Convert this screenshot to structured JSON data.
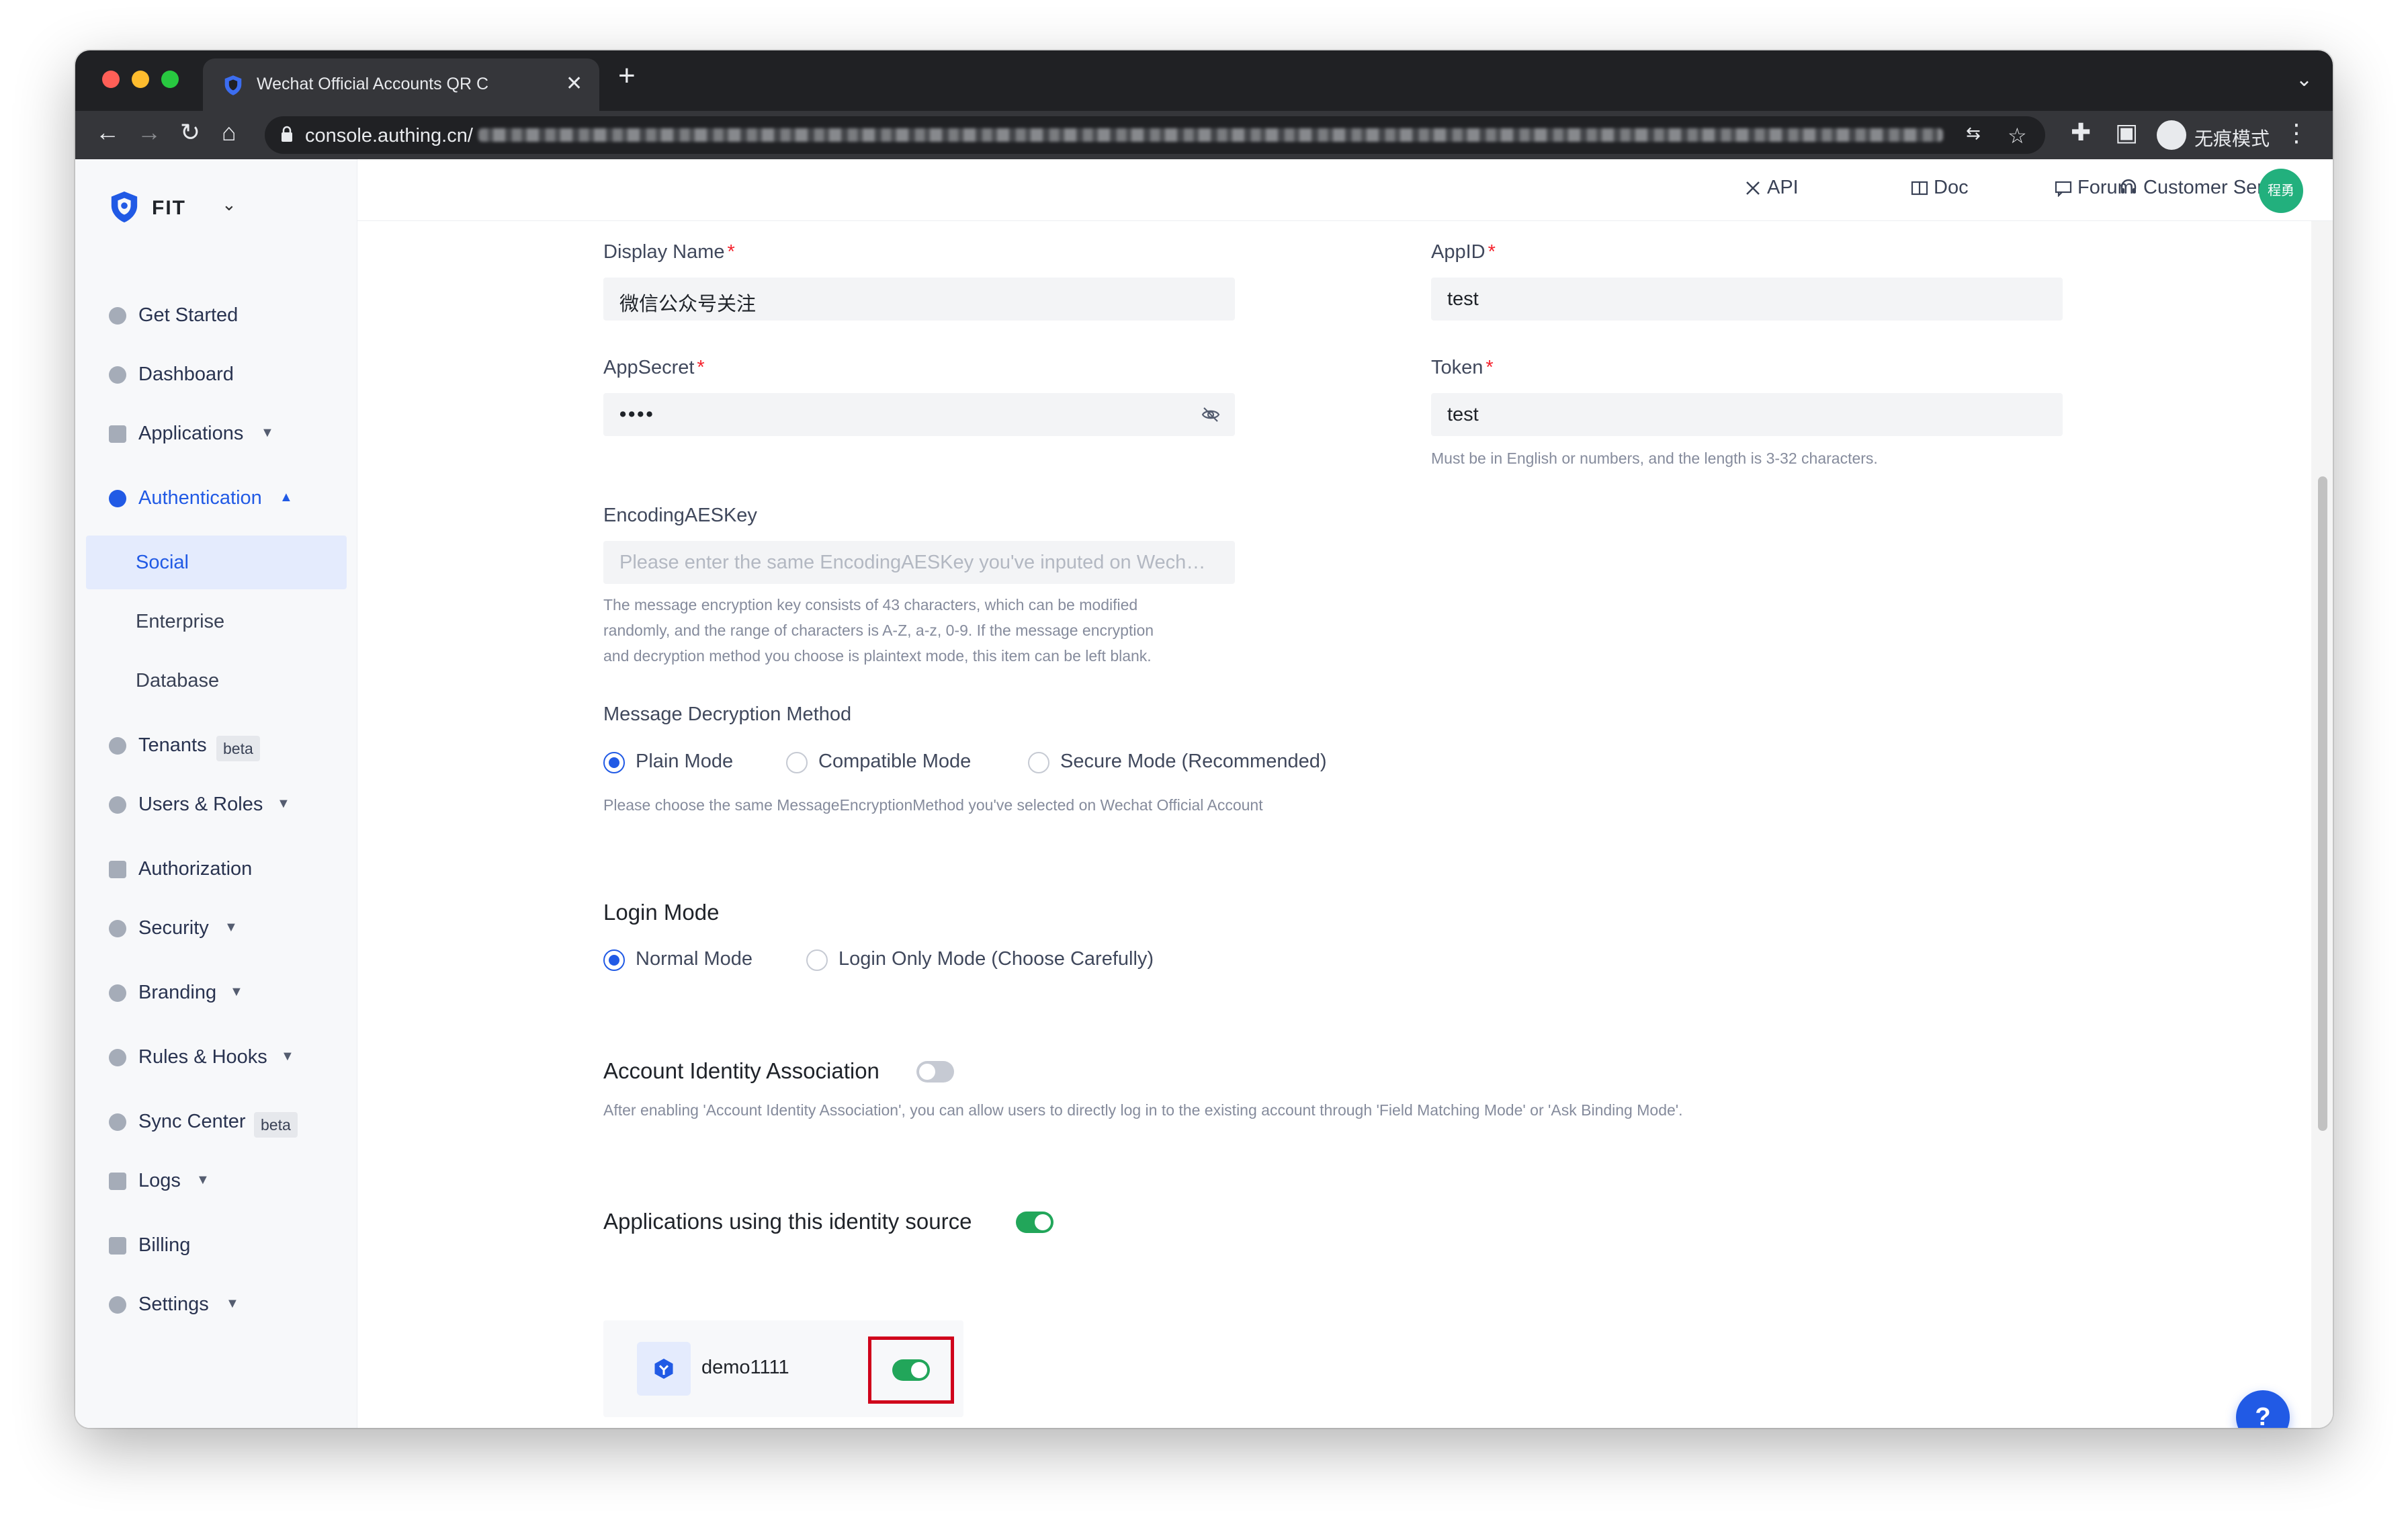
{
  "browser": {
    "tab_title": "Wechat Official Accounts QR C",
    "url_host": "console.authing.cn/",
    "incognito_label": "无痕模式"
  },
  "sidebar": {
    "brand_name": "FIT",
    "items": [
      {
        "label": "Get Started"
      },
      {
        "label": "Dashboard"
      },
      {
        "label": "Applications"
      },
      {
        "label": "Authentication"
      },
      {
        "label": "Tenants",
        "badge": "beta"
      },
      {
        "label": "Users & Roles"
      },
      {
        "label": "Authorization"
      },
      {
        "label": "Security"
      },
      {
        "label": "Branding"
      },
      {
        "label": "Rules & Hooks"
      },
      {
        "label": "Sync Center",
        "badge": "beta"
      },
      {
        "label": "Logs"
      },
      {
        "label": "Billing"
      },
      {
        "label": "Settings"
      }
    ],
    "sub_items": [
      {
        "label": "Social"
      },
      {
        "label": "Enterprise"
      },
      {
        "label": "Database"
      }
    ]
  },
  "topbar": {
    "api": "API",
    "doc": "Doc",
    "forum": "Forum",
    "customer_service": "Customer Service",
    "avatar_text": "程勇"
  },
  "form": {
    "display_name": {
      "label": "Display Name",
      "value": "微信公众号关注"
    },
    "app_id": {
      "label": "AppID",
      "value": "test"
    },
    "app_secret": {
      "label": "AppSecret",
      "value": "••••"
    },
    "token": {
      "label": "Token",
      "value": "test",
      "help": "Must be in English or numbers, and the length is 3-32 characters."
    },
    "encoding_aes_key": {
      "label": "EncodingAESKey",
      "placeholder": "Please enter the same EncodingAESKey you've inputed on Wecha...",
      "help_lines": [
        "The message encryption key consists of 43 characters, which can be modified",
        "randomly, and the range of characters is A-Z, a-z, 0-9. If the message encryption",
        "and decryption method you choose is plaintext mode, this item can be left blank."
      ]
    },
    "decryption": {
      "label": "Message Decryption Method",
      "options": [
        "Plain Mode",
        "Compatible Mode",
        "Secure Mode (Recommended)"
      ],
      "selected": "Plain Mode",
      "help": "Please choose the same MessageEncryptionMethod you've selected on Wechat Official Account"
    },
    "login_mode": {
      "title": "Login Mode",
      "options": [
        "Normal Mode",
        "Login Only Mode (Choose Carefully)"
      ],
      "selected": "Normal Mode"
    },
    "account_identity": {
      "title": "Account Identity Association",
      "enabled": false,
      "help": "After enabling 'Account Identity Association', you can allow users to directly log in to the existing account through 'Field Matching Mode' or 'Ask Binding Mode'."
    },
    "applications": {
      "title": "Applications using this identity source",
      "enabled": true,
      "items": [
        {
          "name": "demo1111",
          "enabled": true
        }
      ]
    }
  },
  "help_button": "?",
  "colors": {
    "primary": "#215ae5",
    "toggle_on": "#22a65a",
    "highlight": "#d0021b",
    "required": "#f5222d"
  }
}
